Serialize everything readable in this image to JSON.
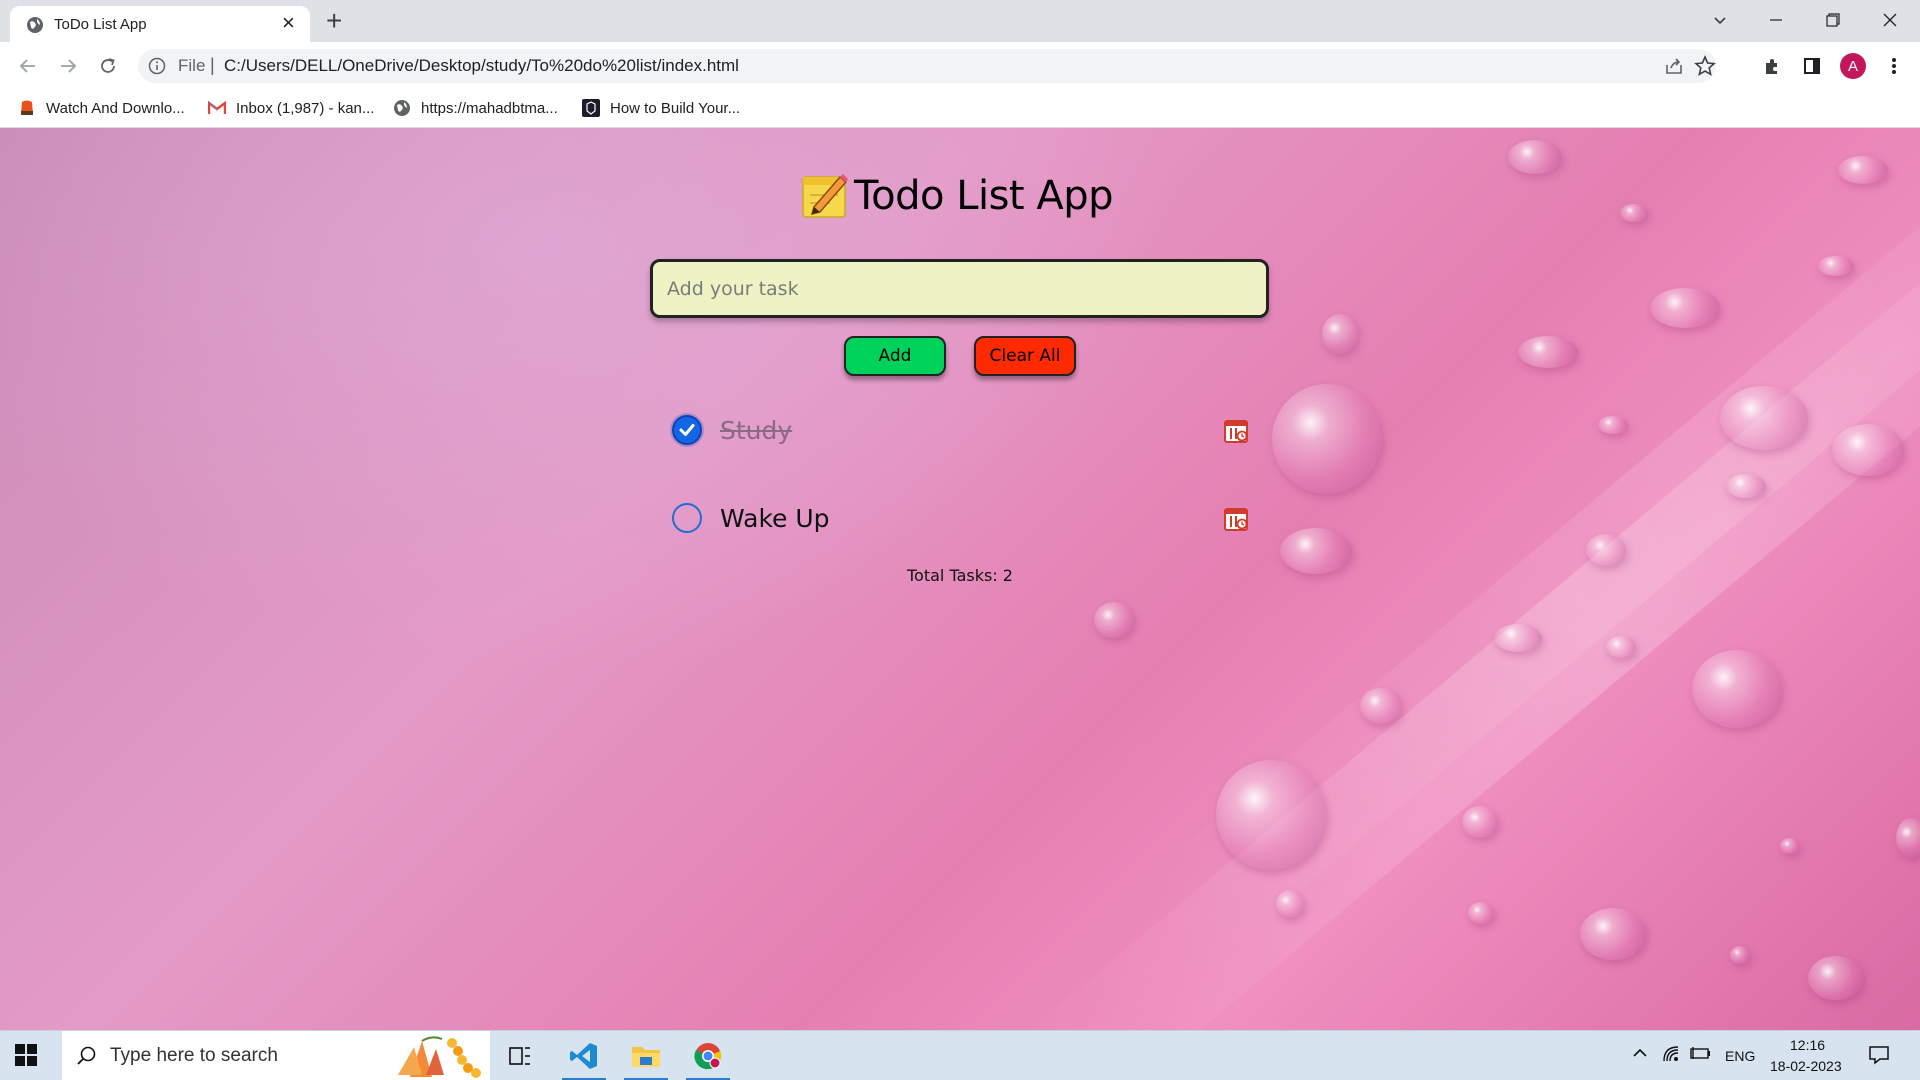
{
  "browser": {
    "tab_title": "ToDo List App",
    "tab_close": "×",
    "new_tab": "+",
    "omnibox_scheme": "File",
    "omnibox_separator": "|",
    "url": "C:/Users/DELL/OneDrive/Desktop/study/To%20do%20list/index.html",
    "profile_initial": "A",
    "bookmarks": [
      {
        "label": "Watch And Downlo...",
        "icon": "bookmark-video-icon"
      },
      {
        "label": "Inbox (1,987) - kan...",
        "icon": "gmail-icon"
      },
      {
        "label": "https://mahadbtma...",
        "icon": "globe-icon"
      },
      {
        "label": "How to Build Your...",
        "icon": "codepen-icon"
      }
    ]
  },
  "app": {
    "title": "Todo List App",
    "input_placeholder": "Add your task",
    "add_label": "Add",
    "clear_label": "Clear All",
    "tasks": [
      {
        "text": "Study",
        "done": true
      },
      {
        "text": "Wake Up",
        "done": false
      }
    ],
    "total_text": "Total Tasks: 2"
  },
  "taskbar": {
    "search_placeholder": "Type here to search",
    "language": "ENG",
    "time": "12:16",
    "date": "18-02-2023"
  },
  "colors": {
    "add_button": "#00d35c",
    "clear_button": "#ff2a00",
    "input_bg": "#eef3c4",
    "checkbox_done": "#1565e8",
    "profile_avatar": "#c2185b"
  }
}
